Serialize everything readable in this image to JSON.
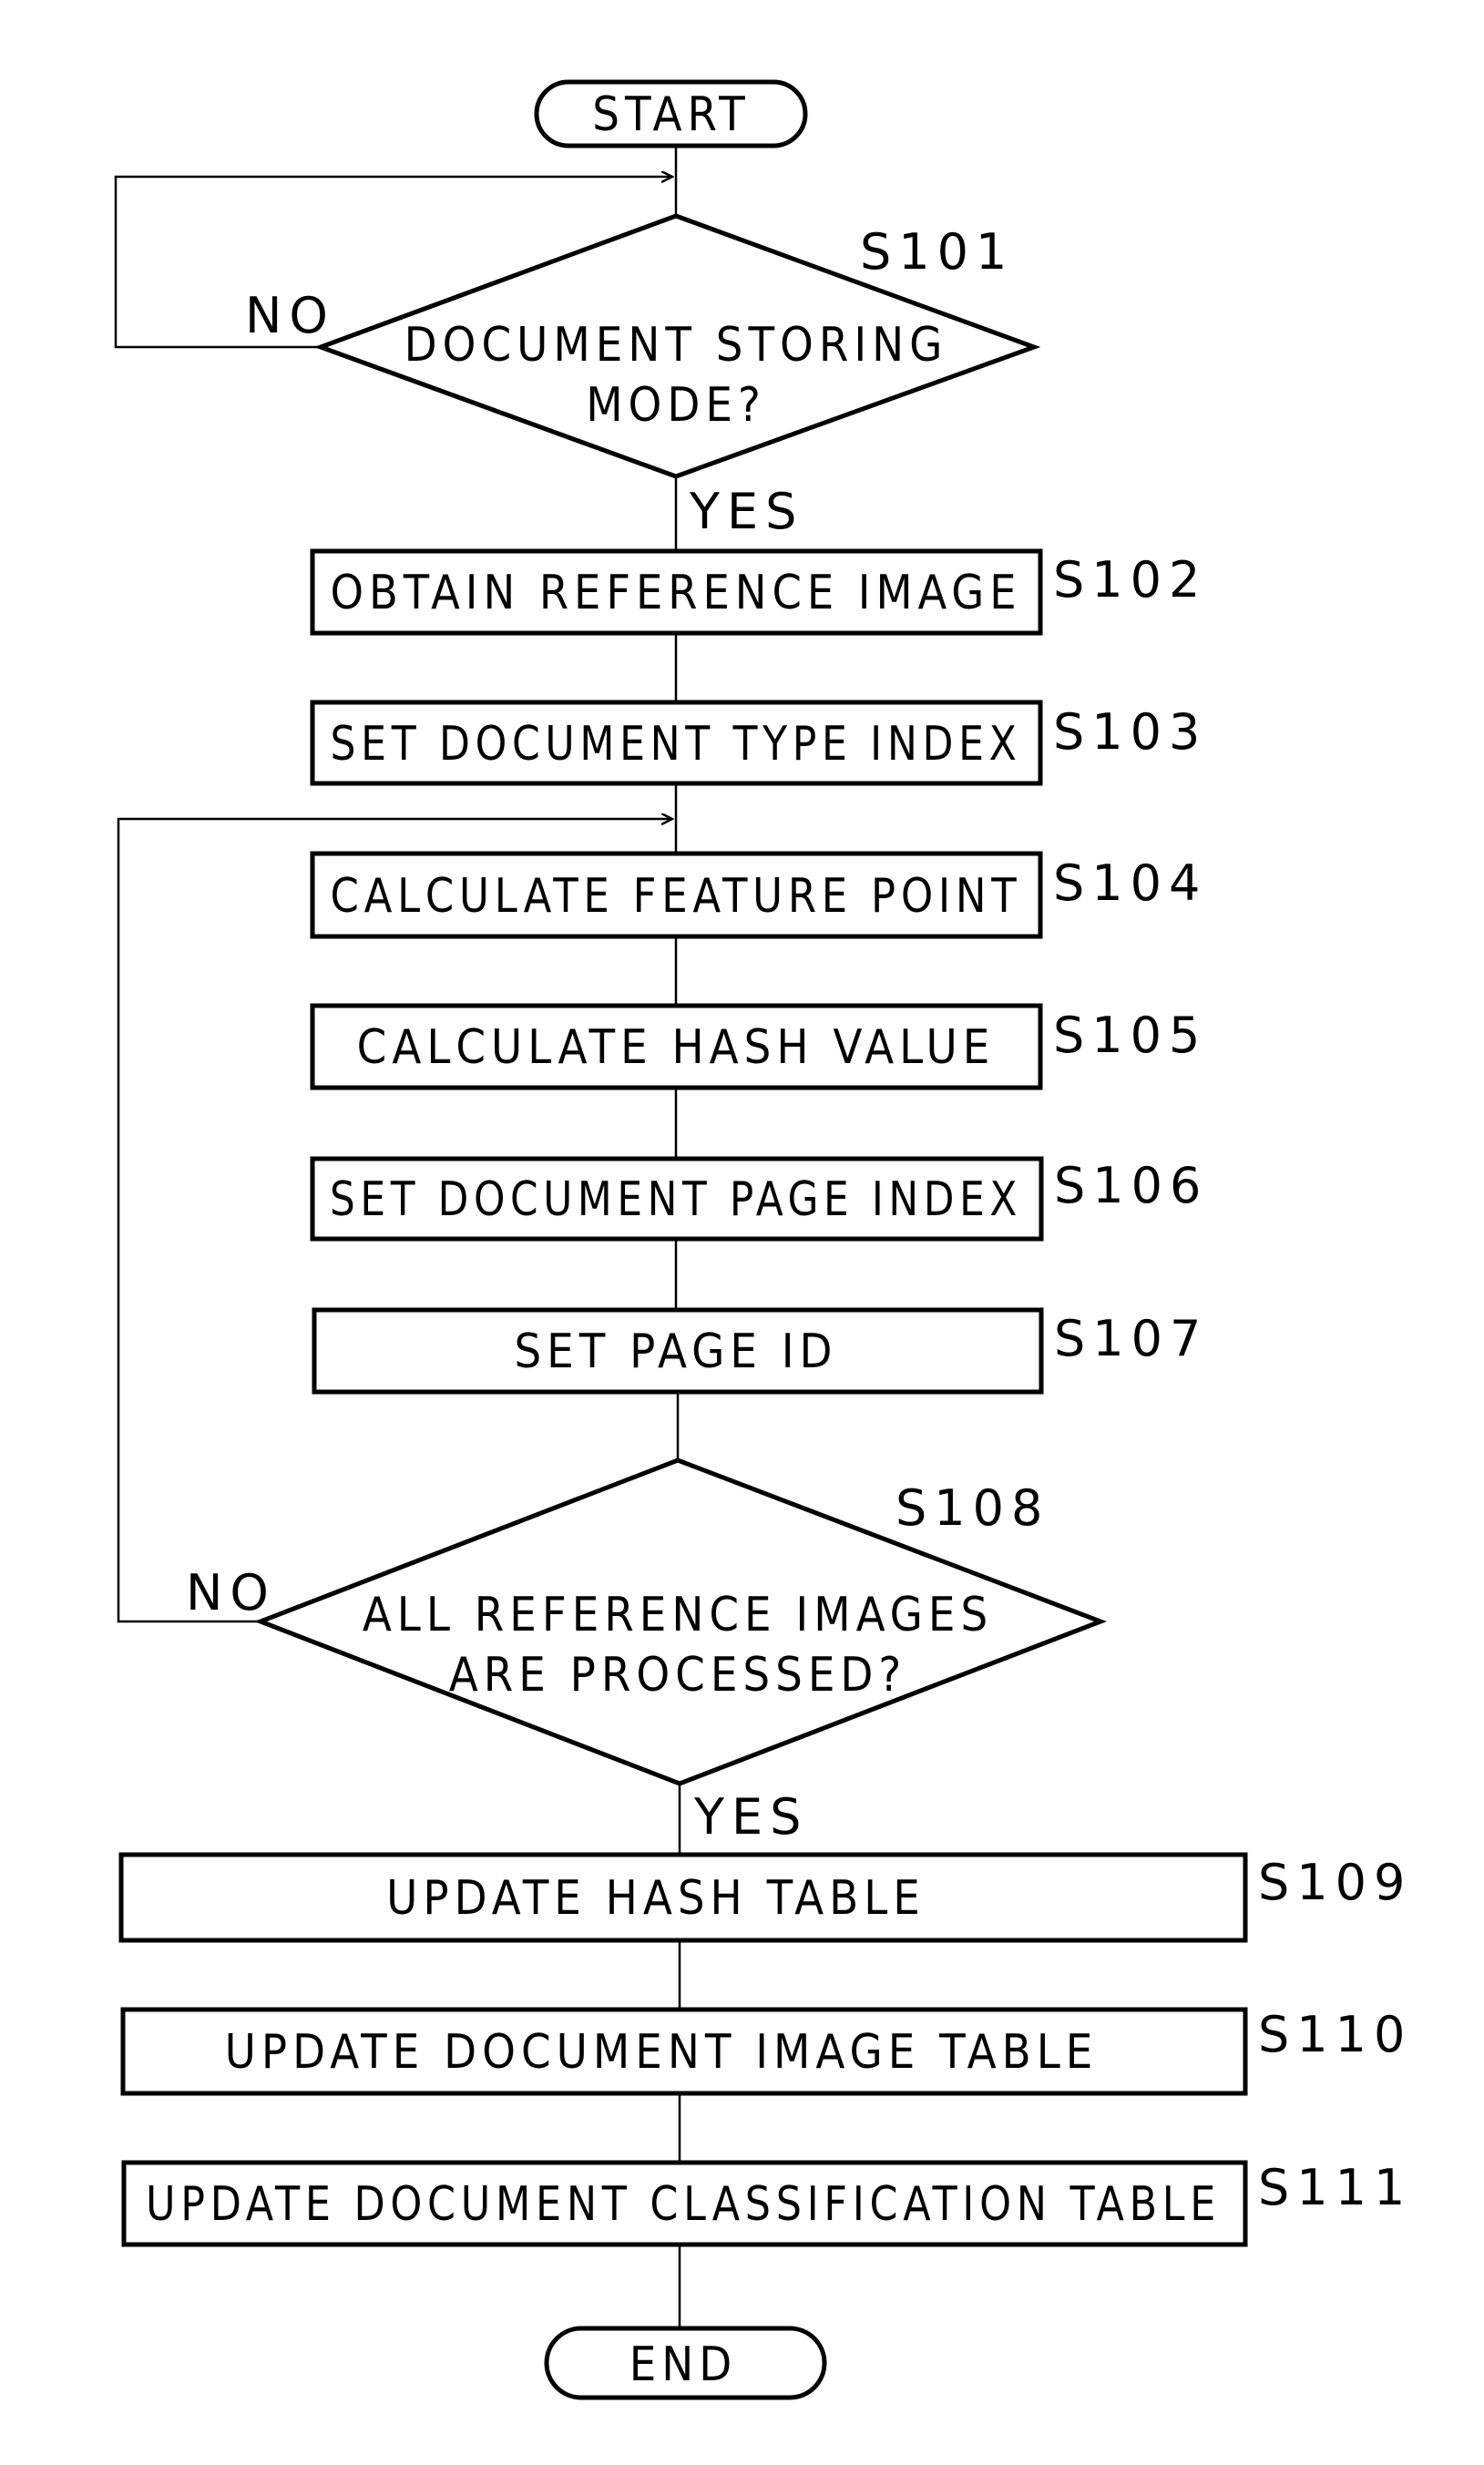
{
  "diagram": {
    "type": "flowchart",
    "terminals": {
      "start": "START",
      "end": "END"
    },
    "steps": [
      {
        "id": "S101",
        "kind": "decision",
        "lines": [
          "DOCUMENT STORING",
          "MODE?"
        ],
        "yes": "YES",
        "no": "NO"
      },
      {
        "id": "S102",
        "kind": "process",
        "text": "OBTAIN REFERENCE IMAGE"
      },
      {
        "id": "S103",
        "kind": "process",
        "text": "SET DOCUMENT TYPE INDEX"
      },
      {
        "id": "S104",
        "kind": "process",
        "text": "CALCULATE FEATURE POINT"
      },
      {
        "id": "S105",
        "kind": "process",
        "text": "CALCULATE HASH VALUE"
      },
      {
        "id": "S106",
        "kind": "process",
        "text": "SET DOCUMENT PAGE INDEX"
      },
      {
        "id": "S107",
        "kind": "process",
        "text": "SET PAGE ID"
      },
      {
        "id": "S108",
        "kind": "decision",
        "lines": [
          "ALL REFERENCE IMAGES",
          "ARE PROCESSED?"
        ],
        "yes": "YES",
        "no": "NO"
      },
      {
        "id": "S109",
        "kind": "process",
        "text": "UPDATE HASH TABLE"
      },
      {
        "id": "S110",
        "kind": "process",
        "text": "UPDATE DOCUMENT IMAGE TABLE"
      },
      {
        "id": "S111",
        "kind": "process",
        "text": "UPDATE DOCUMENT CLASSIFICATION TABLE"
      }
    ],
    "edges": [
      {
        "from": "START",
        "to": "S101"
      },
      {
        "from": "S101",
        "to": "S101",
        "label": "NO"
      },
      {
        "from": "S101",
        "to": "S102",
        "label": "YES"
      },
      {
        "from": "S102",
        "to": "S103"
      },
      {
        "from": "S103",
        "to": "S104"
      },
      {
        "from": "S104",
        "to": "S105"
      },
      {
        "from": "S105",
        "to": "S106"
      },
      {
        "from": "S106",
        "to": "S107"
      },
      {
        "from": "S107",
        "to": "S108"
      },
      {
        "from": "S108",
        "to": "S104",
        "label": "NO"
      },
      {
        "from": "S108",
        "to": "S109",
        "label": "YES"
      },
      {
        "from": "S109",
        "to": "S110"
      },
      {
        "from": "S110",
        "to": "S111"
      },
      {
        "from": "S111",
        "to": "END"
      }
    ]
  }
}
